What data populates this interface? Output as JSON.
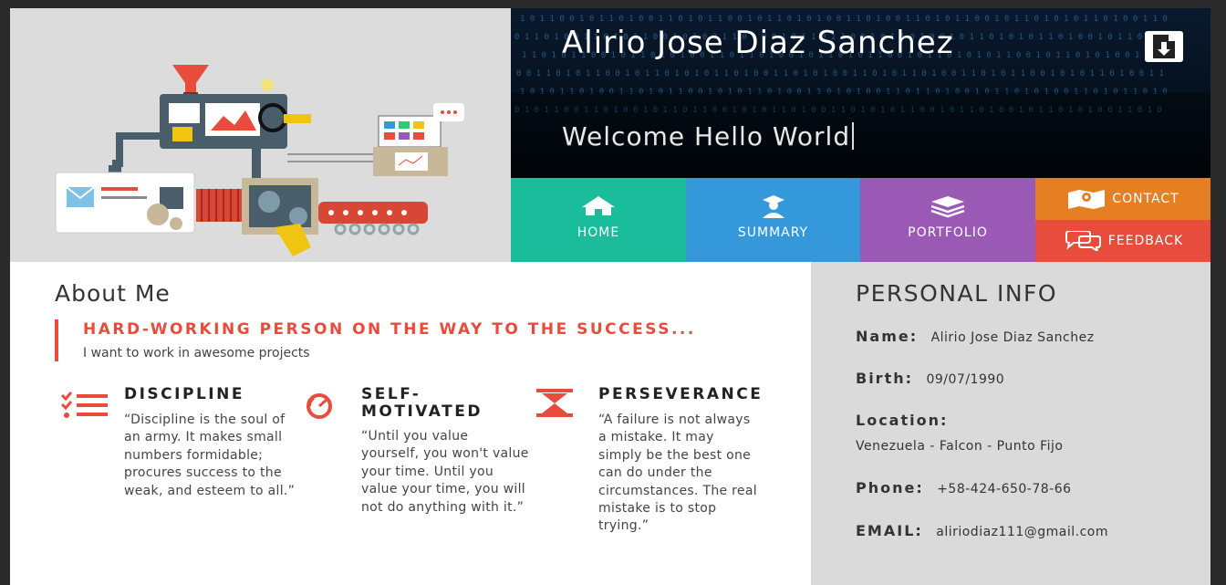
{
  "header": {
    "name": "Alirio Jose Diaz Sanchez",
    "welcome": "Welcome  Hello World",
    "download_icon": "download-icon"
  },
  "nav": {
    "home": "HOME",
    "summary": "SUMMARY",
    "portfolio": "PORTFOLIO",
    "contact": "CONTACT",
    "feedback": "FEEDBACK",
    "colors": {
      "home": "#1abc9c",
      "summary": "#3498db",
      "portfolio": "#9b59b6",
      "contact": "#e67e22",
      "feedback": "#e74c3c"
    }
  },
  "about": {
    "title": "About Me",
    "headline": "HARD-WORKING PERSON ON THE WAY TO THE SUCCESS...",
    "subline": "I want to work in awesome projects",
    "qualities": [
      {
        "title": "DISCIPLINE",
        "icon": "checklist-icon",
        "text": "“Discipline is the soul of an army. It makes small numbers formidable; procures success to the weak, and esteem to all.”"
      },
      {
        "title": "SELF-MOTIVATED",
        "icon": "speedometer-icon",
        "text": "“Until you value yourself, you won't value your time. Until you value your time, you will not do anything with it.”"
      },
      {
        "title": "PERSEVERANCE",
        "icon": "hourglass-icon",
        "text": "“A failure is not always a mistake. It may simply be the best one can do under the circumstances. The real mistake is to stop trying.”"
      }
    ]
  },
  "personal": {
    "title": "PERSONAL INFO",
    "name_label": "Name:",
    "name_value": "Alirio Jose Diaz Sanchez",
    "birth_label": "Birth:",
    "birth_value": "09/07/1990",
    "location_label": "Location:",
    "location_value": "Venezuela - Falcon - Punto Fijo",
    "phone_label": "Phone:",
    "phone_value": "+58-424-650-78-66",
    "email_label": "EMAIL:",
    "email_value": "aliriodiaz111@gmail.com"
  }
}
